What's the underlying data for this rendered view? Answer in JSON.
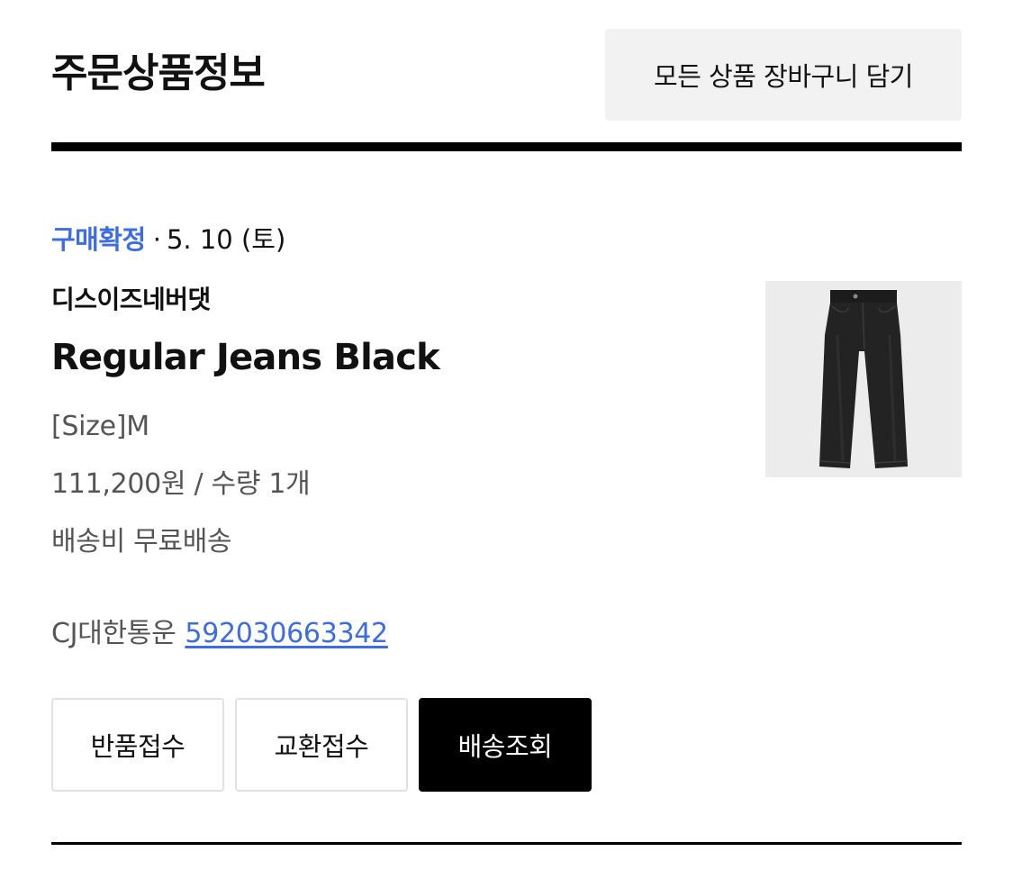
{
  "section": {
    "title": "주문상품정보",
    "add_all_to_cart_label": "모든 상품 장바구니 담기"
  },
  "order_item": {
    "status": "구매확정",
    "separator": "·",
    "date": "5. 10 (토)",
    "brand": "디스이즈네버댓",
    "name": "Regular Jeans Black",
    "option": "[Size]M",
    "price_qty": "111,200원 / 수량 1개",
    "shipping_fee": "배송비 무료배송",
    "courier": "CJ대한통운",
    "tracking_number": "592030663342",
    "thumbnail_icon": "black-jeans-product-image"
  },
  "actions": {
    "return_label": "반품접수",
    "exchange_label": "교환접수",
    "track_label": "배송조회"
  },
  "colors": {
    "accent": "#3d6de3",
    "text": "#111111",
    "muted": "#555555",
    "button_bg_light": "#f2f2f2",
    "button_dark": "#000000"
  }
}
